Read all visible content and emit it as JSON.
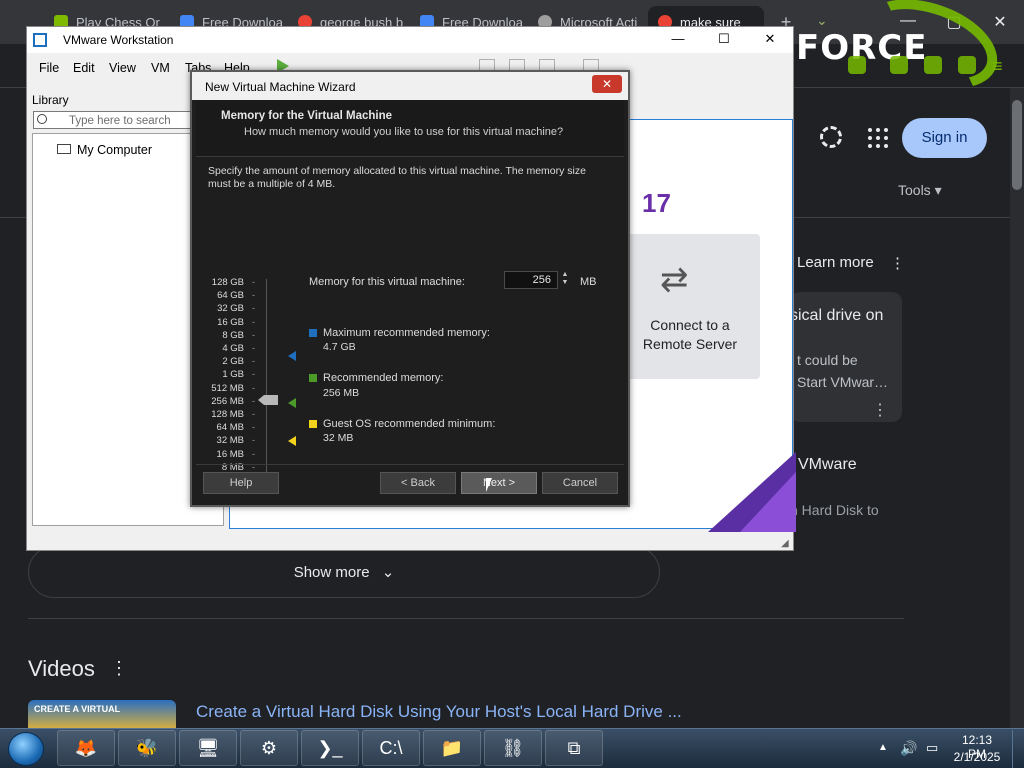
{
  "browser": {
    "tabs": [
      {
        "title": "Play Chess Or",
        "color": "#7fba00"
      },
      {
        "title": "Free Downloa",
        "color": "#4285f4"
      },
      {
        "title": "george bush b",
        "color": "#ea4335"
      },
      {
        "title": "Free Downloa",
        "color": "#4285f4"
      },
      {
        "title": "Microsoft Acti",
        "color": "#9e9e9e"
      },
      {
        "title": "make sure",
        "color": "#ea4335"
      }
    ],
    "new_tab_glyph": "+",
    "tab_search_glyph": "⌄",
    "window_controls": {
      "minimize": "—",
      "maximize": "▢",
      "close": "✕"
    },
    "brand_text": "FORCE",
    "menu_glyph": "≡"
  },
  "bing": {
    "sign_in": "Sign in",
    "tools": "Tools ▾",
    "learn_more": "Learn more",
    "kebab": "⋮",
    "card_title": "sical drive on",
    "card_line1": "t could be",
    "card_line2": "Start VMwar…",
    "vmware_heading": "VMware",
    "vmware_sub": "n Hard Disk to",
    "show_more": "Show more",
    "show_more_chevron": "⌄",
    "videos_title": "Videos",
    "video_thumb_text": "CREATE A VIRTUAL",
    "video_link": "Create a Virtual Hard Disk Using Your Host's Local Hard Drive ..."
  },
  "vmware": {
    "title": "VMware Workstation",
    "controls": {
      "minimize": "—",
      "maximize": "☐",
      "close": "✕"
    },
    "menus": [
      "File",
      "Edit",
      "View",
      "VM",
      "Tabs",
      "Help"
    ],
    "library": {
      "label": "Library",
      "search_placeholder": "Type here to search",
      "items": [
        "My Computer"
      ]
    },
    "home": {
      "version_fragment": "17",
      "connect_label": "Connect to a Remote Server",
      "connect_glyph": "⇄"
    }
  },
  "wizard": {
    "title": "New Virtual Machine Wizard",
    "close_glyph": "✕",
    "header_title": "Memory for the Virtual Machine",
    "header_subtitle": "How much memory would you like to use for this virtual machine?",
    "description": "Specify the amount of memory allocated to this virtual machine. The memory size must be a multiple of 4 MB.",
    "scale": [
      "128 GB",
      "64 GB",
      "32 GB",
      "16 GB",
      "8 GB",
      "4 GB",
      "2 GB",
      "1 GB",
      "512 MB",
      "256 MB",
      "128 MB",
      "64 MB",
      "32 MB",
      "16 MB",
      "8 MB",
      "4 MB"
    ],
    "memory_label": "Memory for this virtual machine:",
    "memory_value": "256",
    "memory_unit": "MB",
    "legend": [
      {
        "title": "Maximum recommended memory:",
        "value": "4.7 GB",
        "color": "#1f6fbf"
      },
      {
        "title": "Recommended memory:",
        "value": "256 MB",
        "color": "#4c9a2a"
      },
      {
        "title": "Guest OS recommended minimum:",
        "value": "32 MB",
        "color": "#f2d21b"
      }
    ],
    "buttons": {
      "help": "Help",
      "back": "< Back",
      "next": "Next >",
      "cancel": "Cancel"
    }
  },
  "taskbar": {
    "apps": [
      {
        "name": "firefox",
        "glyph": "🦊"
      },
      {
        "name": "bee",
        "glyph": "🐝"
      },
      {
        "name": "computer",
        "glyph": "🖥"
      },
      {
        "name": "settings",
        "glyph": "⚙"
      },
      {
        "name": "powershell",
        "glyph": "❯_"
      },
      {
        "name": "cmd",
        "glyph": "C:\\"
      },
      {
        "name": "explorer",
        "glyph": "📁"
      },
      {
        "name": "network",
        "glyph": "⛓"
      },
      {
        "name": "vmware",
        "glyph": "⧉"
      }
    ],
    "tray_arrow": "▲",
    "volume_glyph": "🔊",
    "network_glyph": "▭",
    "time": "12:13 PM",
    "date": "2/1/2025"
  }
}
